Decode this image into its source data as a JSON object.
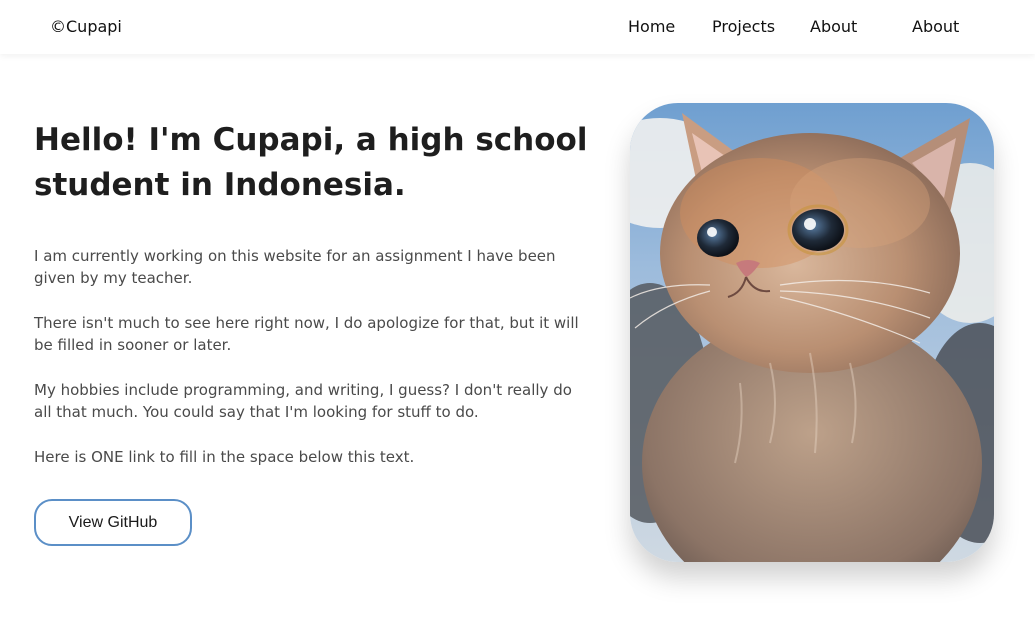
{
  "nav": {
    "brand": "©Cupapi",
    "links": [
      "Home",
      "Projects",
      "About",
      "About"
    ]
  },
  "hero": {
    "headline_line1": "Hello! I'm Cupapi, a high school",
    "headline_line2": "student in Indonesia.",
    "paragraphs": [
      "I am currently working on this website for an assignment I have been given by my teacher.",
      "There isn't much to see here right now, I do apologize for that, but it will be filled in sooner or later.",
      "My hobbies include programming, and writing, I guess? I don't really do all that much. You could say that I'm looking for stuff to do.",
      "Here is ONE link to fill in the space below this text."
    ],
    "button_label": "View GitHub"
  },
  "colors": {
    "button_border": "#5b8fc7",
    "text_dark": "#1e1e1e",
    "text_body": "#4a4a4a"
  }
}
